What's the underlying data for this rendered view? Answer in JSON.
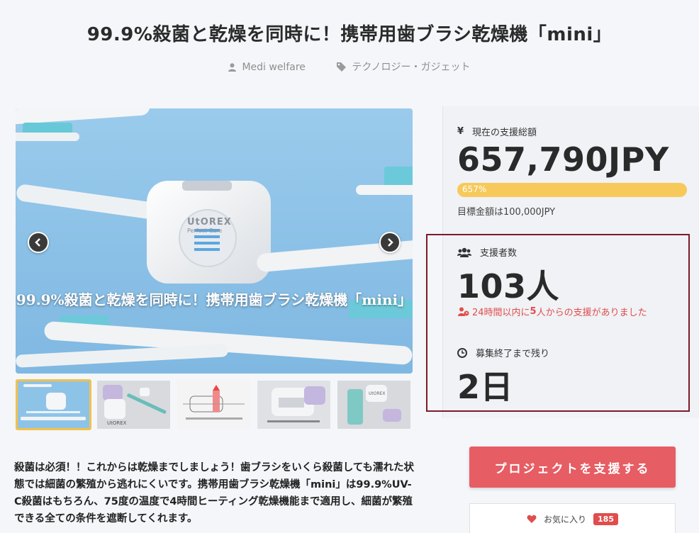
{
  "title": "99.9%殺菌と乾燥を同時に！携帯用歯ブラシ乾燥機「mini」",
  "meta": {
    "author": "Medi welfare",
    "category": "テクノロジー・ガジェット"
  },
  "gallery": {
    "caption": "99.9%殺菌と乾燥を同時に！携帯用歯ブラシ乾燥機「mini」",
    "brand_text": "UtOREX",
    "brand_sub": "Perfect Care",
    "thumbnail_count": 5,
    "active_thumbnail": 0
  },
  "stats": {
    "total_label": "現在の支援総額",
    "total_amount": "657,790JPY",
    "progress_label": "657%",
    "goal_text": "目標金額は100,000JPY",
    "supporters_label": "支援者数",
    "supporters_value": "103人",
    "recent_prefix": "24時間以内に",
    "recent_count": "5",
    "recent_suffix": "人からの支援がありました",
    "remaining_label": "募集終了まで残り",
    "remaining_value": "2日"
  },
  "actions": {
    "support_button": "プロジェクトを支援する",
    "favorite_label": "お気に入り",
    "favorite_count": "185"
  },
  "description": "殺菌は必須！！これからは乾燥までしましょう！歯ブラシをいくら殺菌しても濡れた状態では細菌の繁殖から逃れにくいです。携帯用歯ブラシ乾燥機「mini」は99.9%UV-C殺菌はもちろん、75度の温度で4時間ヒーティング乾燥機能まで適用し、細菌が繁殖できる全ての条件を遮断してくれます。",
  "colors": {
    "accent": "#e65d64",
    "progress": "#f7c95a",
    "highlight_border": "#7d1a2a",
    "alert": "#e04d4d"
  }
}
